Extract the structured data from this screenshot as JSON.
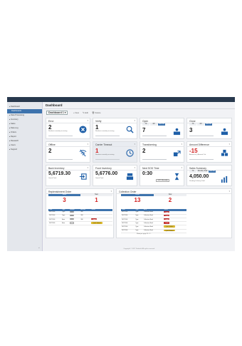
{
  "sidebar": {
    "items": [
      {
        "label": "▸ Dashboard"
      },
      {
        "label": "Dashboards"
      },
      {
        "label": "▸ Data Processing"
      },
      {
        "label": "▸ Inventory"
      },
      {
        "label": "▸ Sales"
      },
      {
        "label": "▸ Data Log"
      },
      {
        "label": "▸ Orders"
      },
      {
        "label": "▸ Report"
      },
      {
        "label": "▸ Research"
      },
      {
        "label": "▸ Users"
      },
      {
        "label": "▸ Support"
      }
    ],
    "collapse_label": "«"
  },
  "header": {
    "title": "Dashboard",
    "dashboard_select": "Dashboard 1 ▾",
    "toolbar": {
      "new": "+ New",
      "edit": "✎ Edit",
      "delete": "🗑 Delete"
    }
  },
  "cards": {
    "error": {
      "title": "Error",
      "value": "2",
      "sub": "Number currently occurring",
      "icon": "error-x-icon",
      "color": "#1e5fa8"
    },
    "verify": {
      "title": "Verify",
      "value": "1",
      "sub": "Number currently occurring",
      "icon": "search-icon"
    },
    "open": {
      "title": "Open",
      "tabs": [
        "7D",
        "1M",
        "Last 6D"
      ],
      "value": "7",
      "icon": "person-desk-icon"
    },
    "close": {
      "title": "Close",
      "tabs": [
        "7D",
        "1M",
        "Last 6D"
      ],
      "value": "3",
      "icon": "person-desk-icon"
    },
    "offline": {
      "title": "Offline",
      "value": "2",
      "icon": "offline-icon"
    },
    "carrier": {
      "title": "Carrier Timeout",
      "value": "1",
      "sub": "Number currently occurring",
      "icon": "clock-icon",
      "value_color": "#d21f1f"
    },
    "transform": {
      "title": "Transforming",
      "value": "2",
      "icon": "transform-icon"
    },
    "amount": {
      "title": "Amount Difference",
      "value": "-15",
      "sub": "Amount in | Amount Out",
      "icon": "boxes-icon",
      "value_color": "#d21f1f"
    },
    "backinv": {
      "title": "Back Inventory",
      "value": "5,6719.30",
      "sub": "Grand Total",
      "icon": "arrow-box-icon"
    },
    "frontinv": {
      "title": "Front Inventory",
      "value": "5,6776.00",
      "sub": "Grand Total",
      "icon": "register-icon"
    },
    "nextsod": {
      "title": "Next SOD Time",
      "value": "0:30",
      "button": "SOD Manually",
      "icon": "hourglass-icon"
    },
    "sales": {
      "title": "Sales Summary",
      "tabs": [
        "7D",
        "Monthly Total",
        "Last 6D"
      ],
      "value": "4,050.00",
      "sub": "Pending Delivery Total",
      "icon": "bar-chart-icon"
    }
  },
  "replenishment": {
    "title": "Replenishment Order",
    "col_pend": "Pend",
    "col_new": "New",
    "pend": "3",
    "new": "1",
    "columns": [
      "Orde",
      "Type",
      "Number",
      "Amount",
      "Status"
    ],
    "rows": [
      {
        "order": "20171106",
        "type": "Type",
        "number": "",
        "amount": "360",
        "status": "",
        "status_class": "grey"
      },
      {
        "order": "20171106",
        "type": "Type",
        "number": "",
        "amount": "360",
        "status": "",
        "status_class": "grey"
      },
      {
        "order": "20171106",
        "type": "Auto",
        "number": "",
        "amount": "380",
        "status": "Hold",
        "status_class": "red"
      },
      {
        "order": "20171106",
        "type": "Auto",
        "number": "",
        "amount": "",
        "status": "Quick Submit",
        "status_class": "yellow"
      }
    ]
  },
  "collection": {
    "title": "Collection Order",
    "col_pend": "Pend",
    "col_new": "New",
    "pend": "13",
    "new": "2",
    "columns": [
      "Order",
      "Type",
      "Bank",
      "Status"
    ],
    "rows": [
      {
        "order": "20171106",
        "type": "Type",
        "bank": "Collection Bank",
        "status": "Hold",
        "status_class": "red"
      },
      {
        "order": "20171106",
        "type": "Type",
        "bank": "Collection Bank",
        "status": "Hold",
        "status_class": "red"
      },
      {
        "order": "20171106",
        "type": "Type",
        "bank": "Collection Bank",
        "status": "Hold",
        "status_class": "red"
      },
      {
        "order": "20171106",
        "type": "Type",
        "bank": "Collection Bank",
        "status": "Hold",
        "status_class": "red"
      },
      {
        "order": "20171106",
        "type": "Type",
        "bank": "Collection Bank",
        "status": "Quick Submit",
        "status_class": "yellow"
      },
      {
        "order": "20171106",
        "type": "Type",
        "bank": "Collection Bank",
        "status": "Quick Submit",
        "status_class": "yellow"
      }
    ],
    "pager": "Show per page  10  ‹  1  ›"
  },
  "footer": "Copyright © 2017 Diebold. All rights reserved."
}
